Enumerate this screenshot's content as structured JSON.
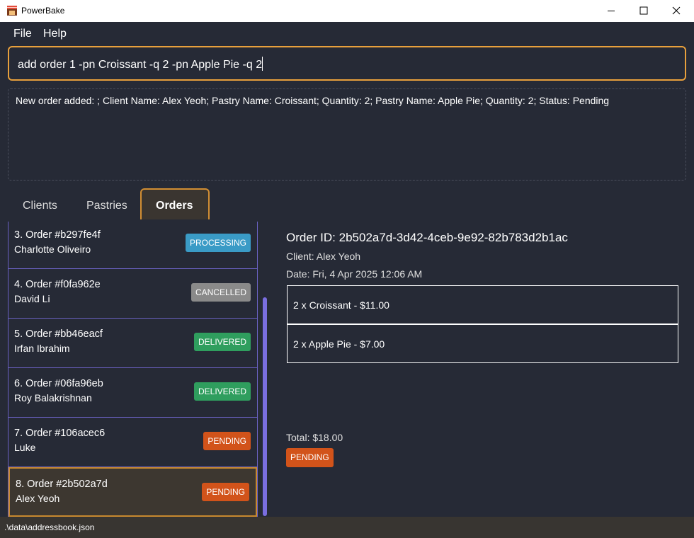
{
  "window": {
    "title": "PowerBake"
  },
  "menu": {
    "file": "File",
    "help": "Help"
  },
  "command": {
    "value": "add order 1 -pn Croissant -q 2 -pn Apple Pie -q 2"
  },
  "result": {
    "text": "New order added: ; Client Name: Alex Yeoh; Pastry Name: Croissant; Quantity: 2; Pastry Name: Apple Pie; Quantity: 2; Status: Pending"
  },
  "tabs": [
    {
      "label": "Clients"
    },
    {
      "label": "Pastries"
    },
    {
      "label": "Orders"
    }
  ],
  "orders": [
    {
      "title": "3. Order #b297fe4f",
      "client": "Charlotte Oliveiro",
      "status": "PROCESSING"
    },
    {
      "title": "4. Order #f0fa962e",
      "client": "David Li",
      "status": "CANCELLED"
    },
    {
      "title": "5. Order #bb46eacf",
      "client": "Irfan Ibrahim",
      "status": "DELIVERED"
    },
    {
      "title": "6. Order #06fa96eb",
      "client": "Roy Balakrishnan",
      "status": "DELIVERED"
    },
    {
      "title": "7. Order #106acec6",
      "client": "Luke",
      "status": "PENDING"
    },
    {
      "title": "8. Order #2b502a7d",
      "client": "Alex Yeoh",
      "status": "PENDING"
    }
  ],
  "detail": {
    "order_id": "Order ID: 2b502a7d-3d42-4ceb-9e92-82b783d2b1ac",
    "client": "Client: Alex Yeoh",
    "date": "Date: Fri, 4 Apr 2025 12:06 AM",
    "items": [
      {
        "text": "2 x Croissant - $11.00"
      },
      {
        "text": "2 x Apple Pie - $7.00"
      }
    ],
    "total": "Total: $18.00",
    "status": "PENDING"
  },
  "statusbar": {
    "path": ".\\data\\addressbook.json"
  },
  "colors": {
    "background": "#262a36",
    "accent": "#e8a03c",
    "processing": "#3a9bc6",
    "cancelled": "#8a8a8a",
    "delivered": "#2f9e5e",
    "pending": "#d2531a",
    "list_border": "#6a61c2"
  }
}
